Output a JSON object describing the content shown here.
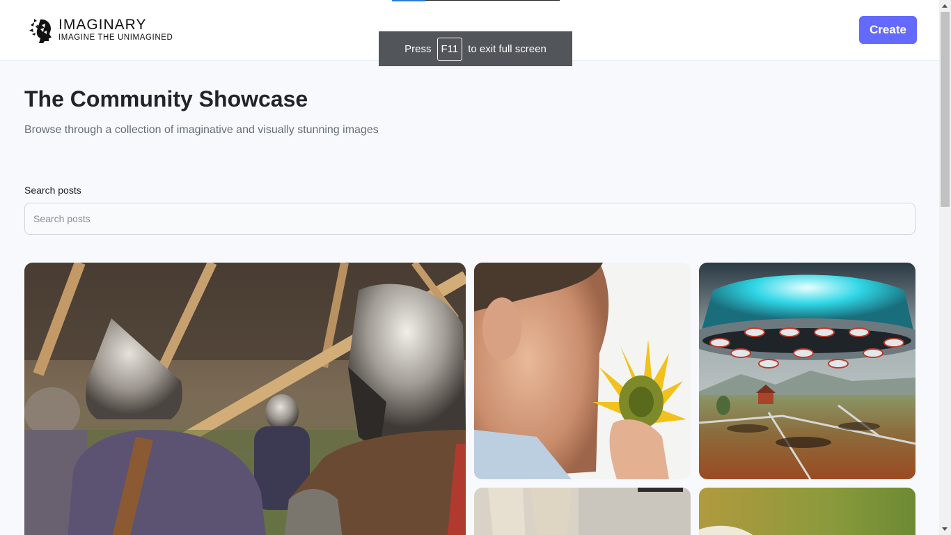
{
  "header": {
    "logo_title": "IMAGINARY",
    "logo_subtitle": "IMAGINE THE UNIMAGINED",
    "create_label": "Create"
  },
  "fullscreen_notice": {
    "prefix": "Press",
    "key": "F11",
    "suffix": "to exit full screen"
  },
  "main": {
    "title": "The Community Showcase",
    "subtitle": "Browse through a collection of imaginative and visually stunning images"
  },
  "search": {
    "label": "Search posts",
    "placeholder": "Search posts",
    "value": ""
  },
  "gallery": {
    "images": [
      "knights-in-helmets-image",
      "man-smelling-sunflower-image",
      "ufo-over-field-image",
      "beach-walkers-image",
      "green-textured-image"
    ]
  },
  "colors": {
    "accent": "#6469ff",
    "title": "#222328",
    "subtitle": "#666e75",
    "background": "#f8f9fd"
  }
}
